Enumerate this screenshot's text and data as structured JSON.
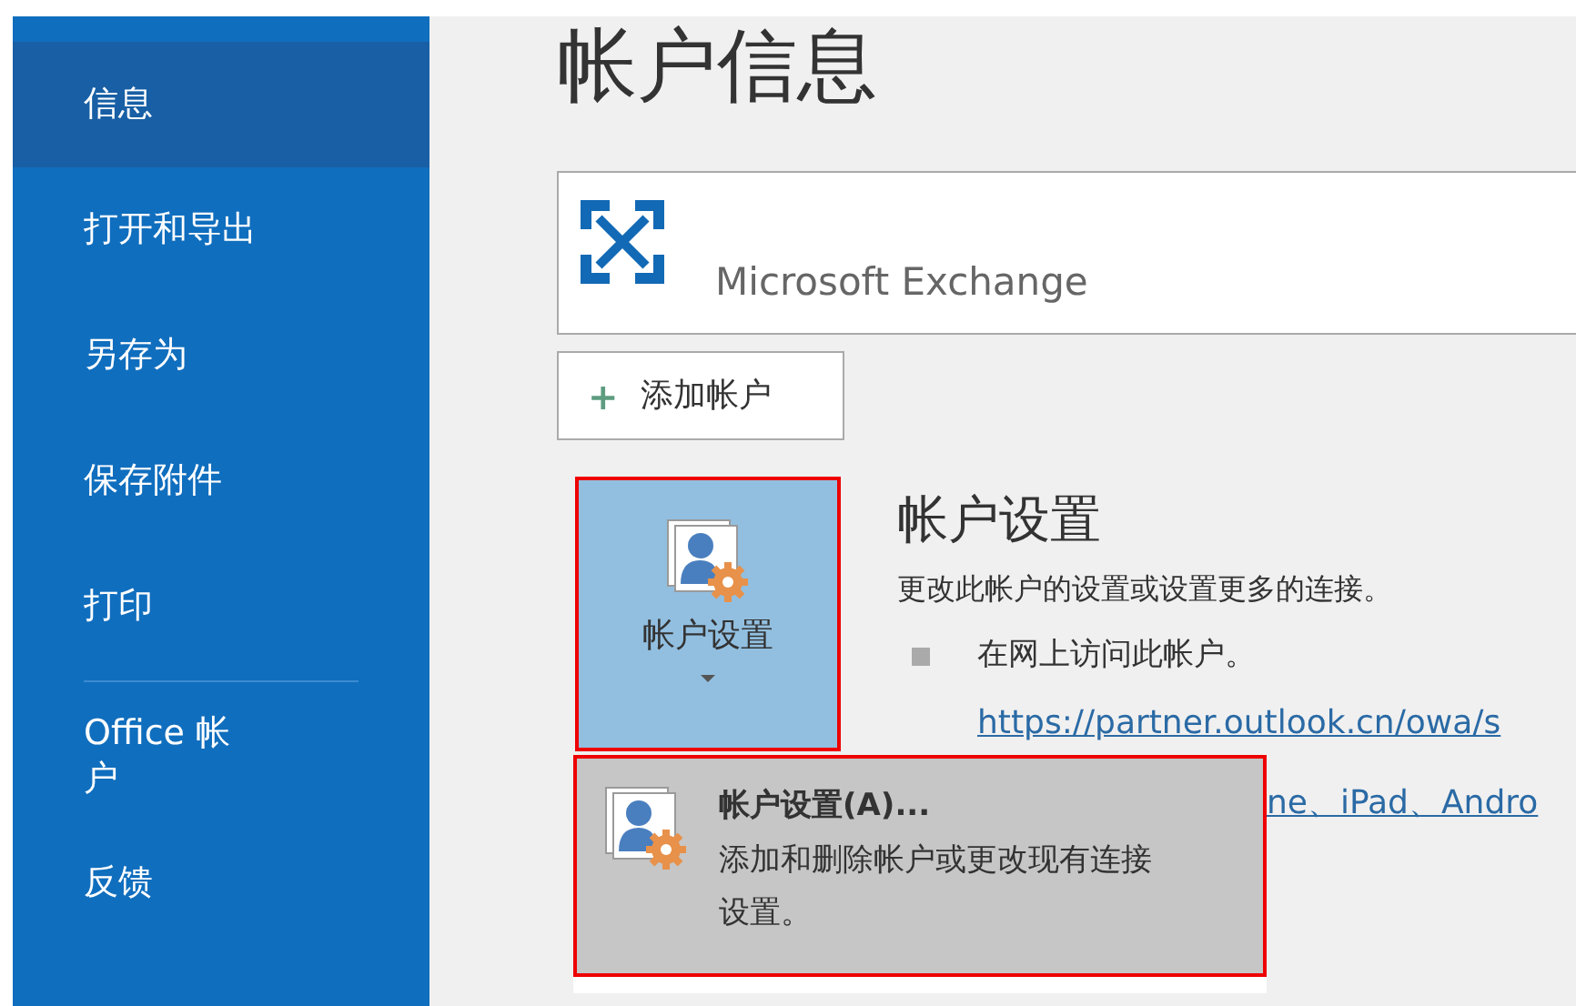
{
  "sidebar": {
    "items": [
      {
        "label": "信息",
        "selected": true
      },
      {
        "label": "打开和导出",
        "selected": false
      },
      {
        "label": "另存为",
        "selected": false
      },
      {
        "label": "保存附件",
        "selected": false
      },
      {
        "label": "打印",
        "selected": false
      },
      {
        "label": "Office 帐户",
        "selected": false,
        "divider_before": true
      },
      {
        "label": "反馈",
        "selected": false
      }
    ]
  },
  "page_title": "帐户信息",
  "account_card": {
    "name": "Microsoft Exchange"
  },
  "add_account_button": {
    "icon": "+",
    "label": "添加帐户"
  },
  "account_settings": {
    "button_label": "帐户设置",
    "title": "帐户设置",
    "description": "更改此帐户的设置或设置更多的连接。",
    "bullet": "在网上访问此帐户。",
    "link": "https://partner.outlook.cn/owa/s",
    "link_2": "ne、iPad、Andro"
  },
  "menu": {
    "items": [
      {
        "title": "帐户设置(A)...",
        "description": "添加和删除帐户或更改现有连接设置。",
        "selected": true
      }
    ]
  }
}
